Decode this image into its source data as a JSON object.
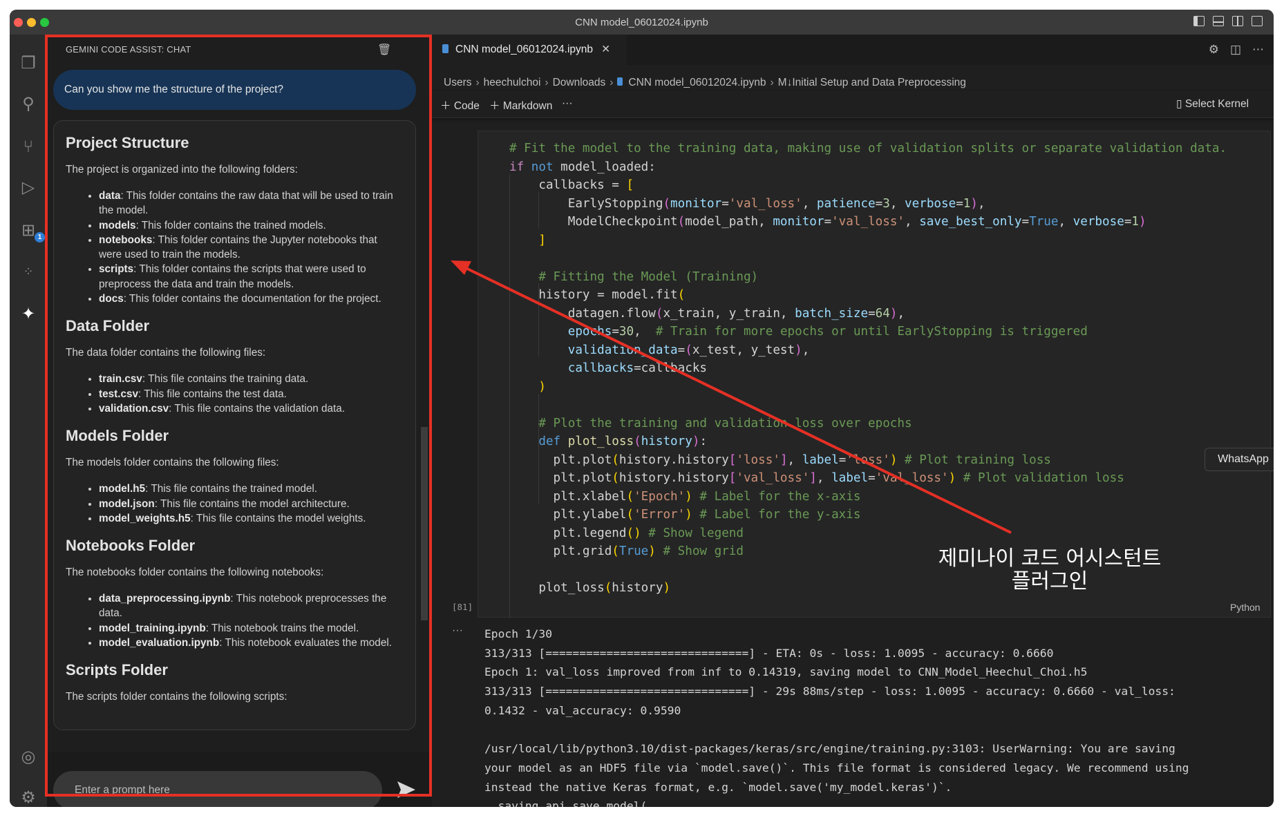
{
  "window": {
    "title": "CNN model_06012024.ipynb",
    "traffic_lights": {
      "close": "#ff5f57",
      "minimize": "#febc2e",
      "maximize": "#28c840"
    }
  },
  "activity_bar": {
    "items": [
      {
        "icon": "files-icon"
      },
      {
        "icon": "search-icon"
      },
      {
        "icon": "source-control-icon"
      },
      {
        "icon": "run-debug-icon"
      },
      {
        "icon": "extensions-icon",
        "badge": "1"
      },
      {
        "icon": "remote-icon"
      },
      {
        "icon": "gemini-sparkle-icon"
      }
    ],
    "bottom": [
      {
        "icon": "account-icon"
      },
      {
        "icon": "settings-gear-icon"
      }
    ]
  },
  "chat": {
    "header": "GEMINI CODE ASSIST: CHAT",
    "user_message": "Can you show me the structure of the project?",
    "response": {
      "sections": [
        {
          "heading": "Project Structure",
          "intro": "The project is organized into the following folders:",
          "items": [
            {
              "name": "data",
              "text": ": This folder contains the raw data that will be used to train the model."
            },
            {
              "name": "models",
              "text": ": This folder contains the trained models."
            },
            {
              "name": "notebooks",
              "text": ": This folder contains the Jupyter notebooks that were used to train the models."
            },
            {
              "name": "scripts",
              "text": ": This folder contains the scripts that were used to preprocess the data and train the models."
            },
            {
              "name": "docs",
              "text": ": This folder contains the documentation for the project."
            }
          ]
        },
        {
          "heading": "Data Folder",
          "intro": "The data folder contains the following files:",
          "items": [
            {
              "name": "train.csv",
              "text": ": This file contains the training data."
            },
            {
              "name": "test.csv",
              "text": ": This file contains the test data."
            },
            {
              "name": "validation.csv",
              "text": ": This file contains the validation data."
            }
          ]
        },
        {
          "heading": "Models Folder",
          "intro": "The models folder contains the following files:",
          "items": [
            {
              "name": "model.h5",
              "text": ": This file contains the trained model."
            },
            {
              "name": "model.json",
              "text": ": This file contains the model architecture."
            },
            {
              "name": "model_weights.h5",
              "text": ": This file contains the model weights."
            }
          ]
        },
        {
          "heading": "Notebooks Folder",
          "intro": "The notebooks folder contains the following notebooks:",
          "items": [
            {
              "name": "data_preprocessing.ipynb",
              "text": ": This notebook preprocesses the data."
            },
            {
              "name": "model_training.ipynb",
              "text": ": This notebook trains the model."
            },
            {
              "name": "model_evaluation.ipynb",
              "text": ": This notebook evaluates the model."
            }
          ]
        },
        {
          "heading": "Scripts Folder",
          "intro": "The scripts folder contains the following scripts:",
          "items": []
        }
      ]
    },
    "prompt_placeholder": "Enter a prompt here"
  },
  "editor": {
    "tab": {
      "label": "CNN model_06012024.ipynb",
      "close": "✕"
    },
    "breadcrumb": [
      "Users",
      "heechulchoi",
      "Downloads",
      "CNN model_06012024.ipynb",
      "M↓Initial Setup and Data Preprocessing"
    ],
    "toolbar": {
      "code": "Code",
      "markdown": "Markdown",
      "more": "···",
      "kernel": "Select Kernel"
    },
    "cell": {
      "execution_count": "[81]",
      "language": "Python",
      "code": [
        [
          [
            "# Fit the model to the training data, making use of validation splits or separate validation data.",
            "c"
          ]
        ],
        [
          [
            "if",
            "k"
          ],
          [
            " ",
            "d"
          ],
          [
            "not",
            "kb"
          ],
          [
            " model_loaded:",
            "d"
          ]
        ],
        [
          [
            "    callbacks = ",
            "d"
          ],
          [
            "[",
            "b1"
          ]
        ],
        [
          [
            "        EarlyStopping",
            "d"
          ],
          [
            "(",
            "b2"
          ],
          [
            "monitor",
            "p"
          ],
          [
            "=",
            "d"
          ],
          [
            "'val_loss'",
            "s"
          ],
          [
            ", ",
            "d"
          ],
          [
            "patience",
            "p"
          ],
          [
            "=",
            "d"
          ],
          [
            "3",
            "n"
          ],
          [
            ", ",
            "d"
          ],
          [
            "verbose",
            "p"
          ],
          [
            "=",
            "d"
          ],
          [
            "1",
            "n"
          ],
          [
            ")",
            "b2"
          ],
          [
            ",",
            "d"
          ]
        ],
        [
          [
            "        ModelCheckpoint",
            "d"
          ],
          [
            "(",
            "b2"
          ],
          [
            "model_path, ",
            "d"
          ],
          [
            "monitor",
            "p"
          ],
          [
            "=",
            "d"
          ],
          [
            "'val_loss'",
            "s"
          ],
          [
            ", ",
            "d"
          ],
          [
            "save_best_only",
            "p"
          ],
          [
            "=",
            "d"
          ],
          [
            "True",
            "kb"
          ],
          [
            ", ",
            "d"
          ],
          [
            "verbose",
            "p"
          ],
          [
            "=",
            "d"
          ],
          [
            "1",
            "n"
          ],
          [
            ")",
            "b2"
          ]
        ],
        [
          [
            "    ",
            "d"
          ],
          [
            "]",
            "b1"
          ]
        ],
        [],
        [
          [
            "    ",
            "d"
          ],
          [
            "# Fitting the Model (Training)",
            "c"
          ]
        ],
        [
          [
            "    history = model.fit",
            "d"
          ],
          [
            "(",
            "b1"
          ]
        ],
        [
          [
            "        datagen.flow",
            "d"
          ],
          [
            "(",
            "b2"
          ],
          [
            "x_train, y_train, ",
            "d"
          ],
          [
            "batch_size",
            "p"
          ],
          [
            "=",
            "d"
          ],
          [
            "64",
            "n"
          ],
          [
            ")",
            "b2"
          ],
          [
            ",",
            "d"
          ]
        ],
        [
          [
            "        ",
            "d"
          ],
          [
            "epochs",
            "p"
          ],
          [
            "=",
            "d"
          ],
          [
            "30",
            "n"
          ],
          [
            ",  ",
            "d"
          ],
          [
            "# Train for more epochs or until EarlyStopping is triggered",
            "c"
          ]
        ],
        [
          [
            "        ",
            "d"
          ],
          [
            "validation_data",
            "p"
          ],
          [
            "=",
            "d"
          ],
          [
            "(",
            "b2"
          ],
          [
            "x_test, y_test",
            "d"
          ],
          [
            ")",
            "b2"
          ],
          [
            ",",
            "d"
          ]
        ],
        [
          [
            "        ",
            "d"
          ],
          [
            "callbacks",
            "p"
          ],
          [
            "=callbacks",
            "d"
          ]
        ],
        [
          [
            "    ",
            "d"
          ],
          [
            ")",
            "b1"
          ]
        ],
        [],
        [
          [
            "    ",
            "d"
          ],
          [
            "# Plot the training and validation loss over epochs",
            "c"
          ]
        ],
        [
          [
            "    ",
            "d"
          ],
          [
            "def",
            "kb"
          ],
          [
            " ",
            "d"
          ],
          [
            "plot_loss",
            "f"
          ],
          [
            "(",
            "b2"
          ],
          [
            "history",
            "p"
          ],
          [
            ")",
            "b2"
          ],
          [
            ":",
            "d"
          ]
        ],
        [
          [
            "      plt.plot",
            "d"
          ],
          [
            "(",
            "b1"
          ],
          [
            "history.history",
            "d"
          ],
          [
            "[",
            "b2"
          ],
          [
            "'loss'",
            "s"
          ],
          [
            "]",
            "b2"
          ],
          [
            ", ",
            "d"
          ],
          [
            "label",
            "p"
          ],
          [
            "=",
            "d"
          ],
          [
            "'loss'",
            "s"
          ],
          [
            ")",
            "b1"
          ],
          [
            " ",
            "d"
          ],
          [
            "# Plot training loss",
            "c"
          ]
        ],
        [
          [
            "      plt.plot",
            "d"
          ],
          [
            "(",
            "b1"
          ],
          [
            "history.history",
            "d"
          ],
          [
            "[",
            "b2"
          ],
          [
            "'val_loss'",
            "s"
          ],
          [
            "]",
            "b2"
          ],
          [
            ", ",
            "d"
          ],
          [
            "label",
            "p"
          ],
          [
            "=",
            "d"
          ],
          [
            "'val_loss'",
            "s"
          ],
          [
            ")",
            "b1"
          ],
          [
            " ",
            "d"
          ],
          [
            "# Plot validation loss",
            "c"
          ]
        ],
        [
          [
            "      plt.xlabel",
            "d"
          ],
          [
            "(",
            "b1"
          ],
          [
            "'Epoch'",
            "s"
          ],
          [
            ")",
            "b1"
          ],
          [
            " ",
            "d"
          ],
          [
            "# Label for the x-axis",
            "c"
          ]
        ],
        [
          [
            "      plt.ylabel",
            "d"
          ],
          [
            "(",
            "b1"
          ],
          [
            "'Error'",
            "s"
          ],
          [
            ")",
            "b1"
          ],
          [
            " ",
            "d"
          ],
          [
            "# Label for the y-axis",
            "c"
          ]
        ],
        [
          [
            "      plt.legend",
            "d"
          ],
          [
            "()",
            "b1"
          ],
          [
            " ",
            "d"
          ],
          [
            "# Show legend",
            "c"
          ]
        ],
        [
          [
            "      plt.grid",
            "d"
          ],
          [
            "(",
            "b1"
          ],
          [
            "True",
            "kb"
          ],
          [
            ")",
            "b1"
          ],
          [
            " ",
            "d"
          ],
          [
            "# Show grid",
            "c"
          ]
        ],
        [],
        [
          [
            "    plot_loss",
            "d"
          ],
          [
            "(",
            "b1"
          ],
          [
            "history",
            "d"
          ],
          [
            ")",
            "b1"
          ]
        ]
      ],
      "output_marker": "···",
      "output": [
        "Epoch 1/30",
        "313/313 [==============================] - ETA: 0s - loss: 1.0095 - accuracy: 0.6660",
        "Epoch 1: val_loss improved from inf to 0.14319, saving model to CNN_Model_Heechul_Choi.h5",
        "313/313 [==============================] - 29s 88ms/step - loss: 1.0095 - accuracy: 0.6660 - val_loss:",
        "0.1432 - val_accuracy: 0.9590",
        "",
        "/usr/local/lib/python3.10/dist-packages/keras/src/engine/training.py:3103: UserWarning: You are saving",
        "your model as an HDF5 file via `model.save()`. This file format is considered legacy. We recommend using",
        "instead the native Keras format, e.g. `model.save('my_model.keras')`.",
        "  saving_api.save_model("
      ]
    }
  },
  "tooltip": "WhatsApp",
  "annotation": {
    "lines": [
      "제미나이 코드 어시스턴트",
      "플러그인"
    ],
    "color": "#e53025"
  }
}
